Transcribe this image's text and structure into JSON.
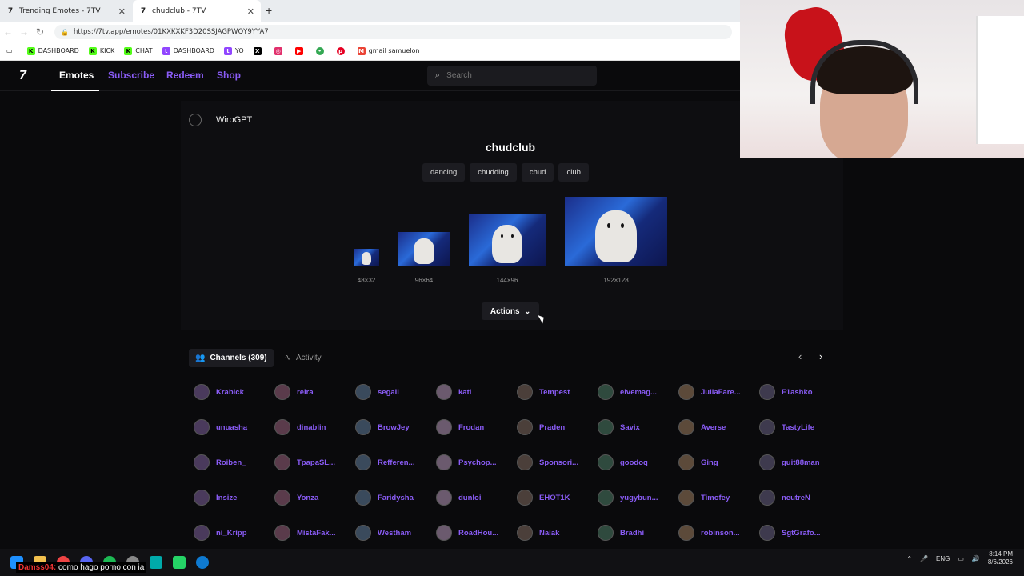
{
  "browser": {
    "tabs": [
      {
        "title": "Trending Emotes - 7TV",
        "favicon": "7"
      },
      {
        "title": "chudclub - 7TV",
        "favicon": "7"
      }
    ],
    "url": "https://7tv.app/emotes/01KXKXKF3D20SSJAGPWQY9YYA7",
    "bookmarks": [
      {
        "label": "DASHBOARD",
        "color": "#53fc18"
      },
      {
        "label": "KICK",
        "color": "#53fc18"
      },
      {
        "label": "CHAT",
        "color": "#53fc18"
      },
      {
        "label": "DASHBOARD",
        "color": "#9146ff"
      },
      {
        "label": "YO",
        "color": "#9146ff"
      },
      {
        "label": "",
        "color": "#000000"
      },
      {
        "label": "",
        "color": "#e1306c"
      },
      {
        "label": "",
        "color": "#ff0000"
      },
      {
        "label": "",
        "color": "#34a853"
      },
      {
        "label": "",
        "color": "#e60023"
      },
      {
        "label": "gmail samuelon",
        "color": "#ea4335"
      }
    ]
  },
  "nav": {
    "logo": "7",
    "links": [
      "Emotes",
      "Subscribe",
      "Redeem",
      "Shop"
    ],
    "search_placeholder": "Search"
  },
  "emote": {
    "author": "WiroGPT",
    "name": "chudclub",
    "tags": [
      "dancing",
      "chudding",
      "chud",
      "club"
    ],
    "sizes": [
      "48×32",
      "96×64",
      "144×96",
      "192×128"
    ],
    "actions_label": "Actions"
  },
  "channels": {
    "tab_channels": "Channels (309)",
    "tab_activity": "Activity",
    "list": [
      "Krabick",
      "reira",
      "segall",
      "kati",
      "Tempest",
      "elvemag...",
      "JuliaFare...",
      "F1ashko",
      "unuasha",
      "dinablin",
      "BrowJey",
      "Frodan",
      "Praden",
      "Savix",
      "Averse",
      "TastyLife",
      "Roiben_",
      "TpapaSL...",
      "Refferen...",
      "Psychop...",
      "Sponsori...",
      "goodoq",
      "Ging",
      "guit88man",
      "Insize",
      "Yonza",
      "Faridysha",
      "dunloi",
      "EHOT1K",
      "yugybun...",
      "Timofey",
      "neutreN",
      "ni_Kripp",
      "MistaFak...",
      "Westham",
      "RoadHou...",
      "Naiak",
      "Bradhi",
      "robinson...",
      "SgtGrafo..."
    ]
  },
  "overlay": {
    "user": "Damss04:",
    "message": "como hago porno con ia"
  },
  "taskbar": {
    "lang": "ENG",
    "time": "8:14 PM",
    "date": "8/6/2026"
  }
}
